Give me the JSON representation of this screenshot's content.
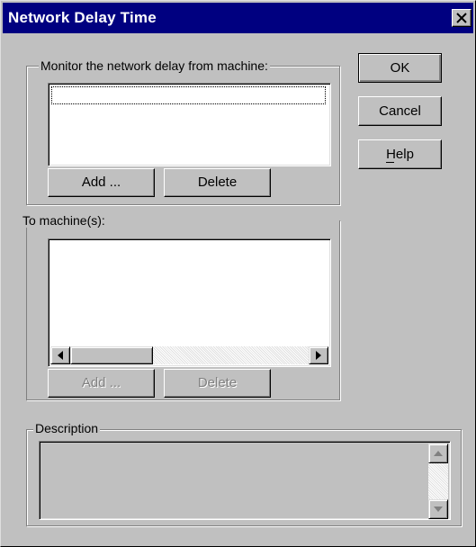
{
  "window": {
    "title": "Network Delay Time"
  },
  "monitor_group": {
    "legend": "Monitor the network delay from machine:",
    "items": [
      ""
    ],
    "add_label": "Add ...",
    "delete_label": "Delete"
  },
  "to_machines": {
    "label": "To machine(s):",
    "items": [],
    "add_label": "Add ...",
    "delete_label": "Delete"
  },
  "buttons": {
    "ok": "OK",
    "cancel": "Cancel",
    "help": "Help"
  },
  "description": {
    "legend": "Description",
    "text": ""
  },
  "colors": {
    "title_bar": "#000080",
    "face": "#c0c0c0",
    "window": "#ffffff",
    "disabled_text": "#808080"
  }
}
